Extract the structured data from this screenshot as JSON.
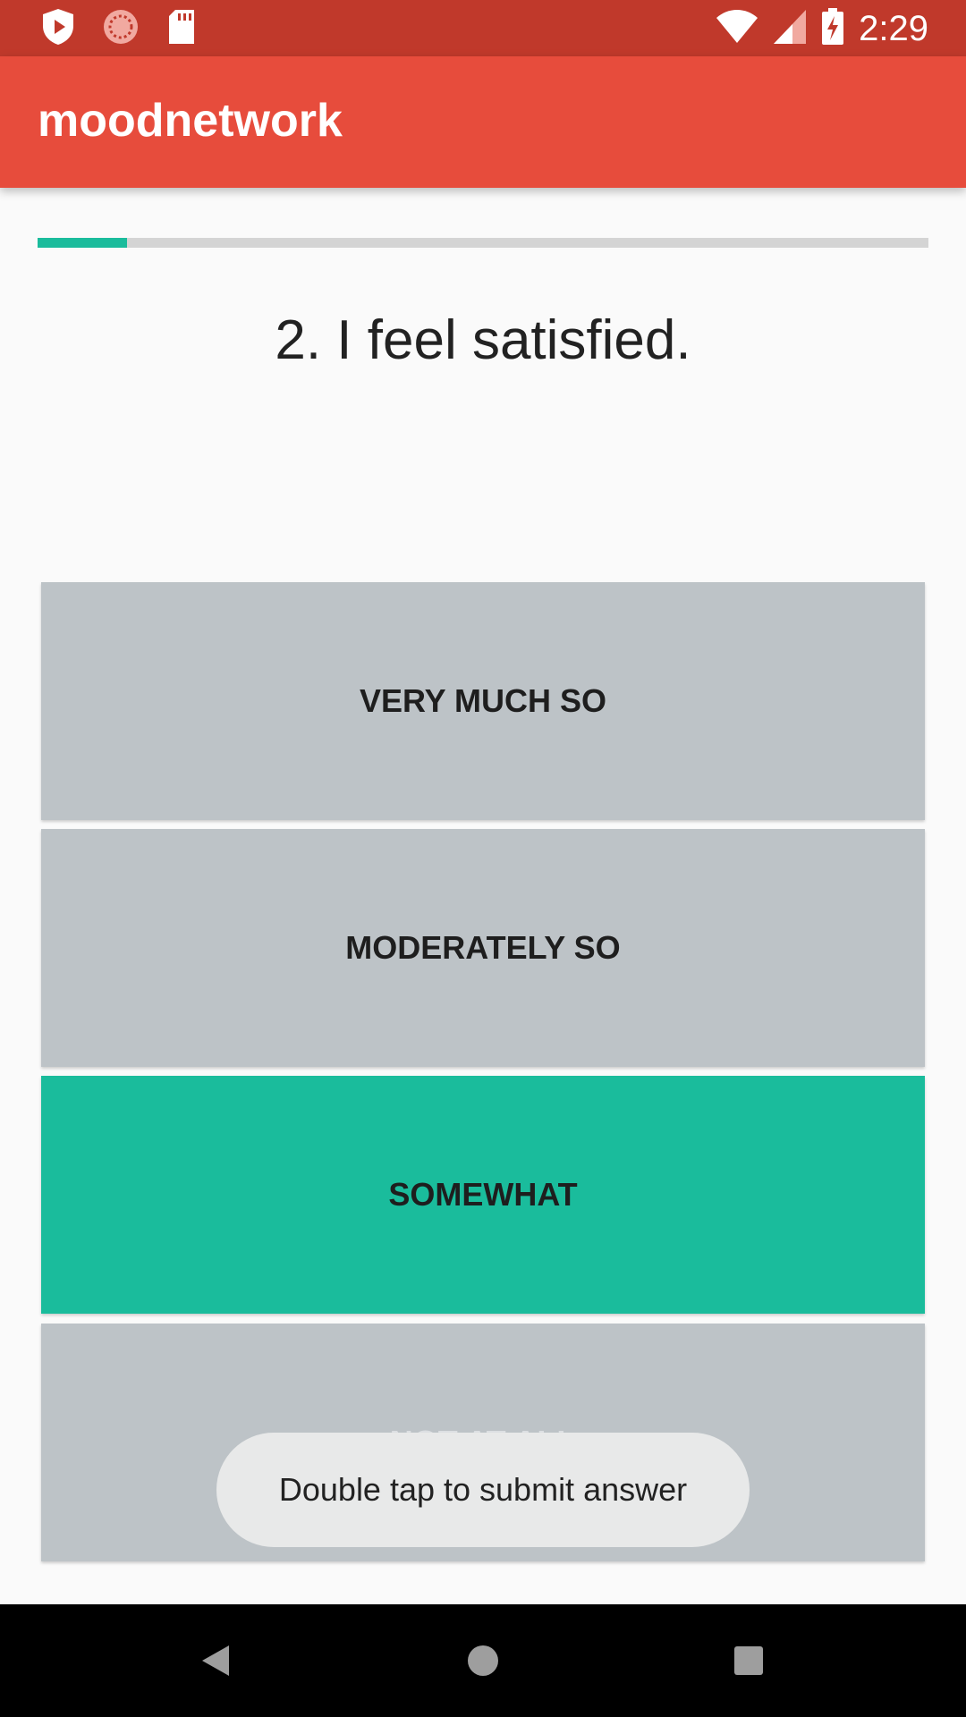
{
  "status_bar": {
    "time": "2:29",
    "icons": [
      "play-shield-icon",
      "sync-circle-icon",
      "sd-card-icon",
      "wifi-icon",
      "cell-signal-icon",
      "battery-charging-icon"
    ]
  },
  "app_bar": {
    "title": "moodnetwork"
  },
  "progress": {
    "fraction": 0.1,
    "color": "#1abc9c"
  },
  "question": {
    "text": "2. I feel satisfied."
  },
  "answers": [
    {
      "label": "VERY MUCH SO",
      "color": "#bdc3c7",
      "selected": false
    },
    {
      "label": "MODERATELY SO",
      "color": "#bdc3c7",
      "selected": false
    },
    {
      "label": "SOMEWHAT",
      "color": "#1abc9c",
      "selected": true
    },
    {
      "label": "NOT AT ALL",
      "color": "#bdc3c7",
      "selected": false
    }
  ],
  "toast": {
    "text": "Double tap to submit answer"
  },
  "nav_bar": {
    "icons": [
      "back-icon",
      "home-icon",
      "recents-icon"
    ]
  }
}
